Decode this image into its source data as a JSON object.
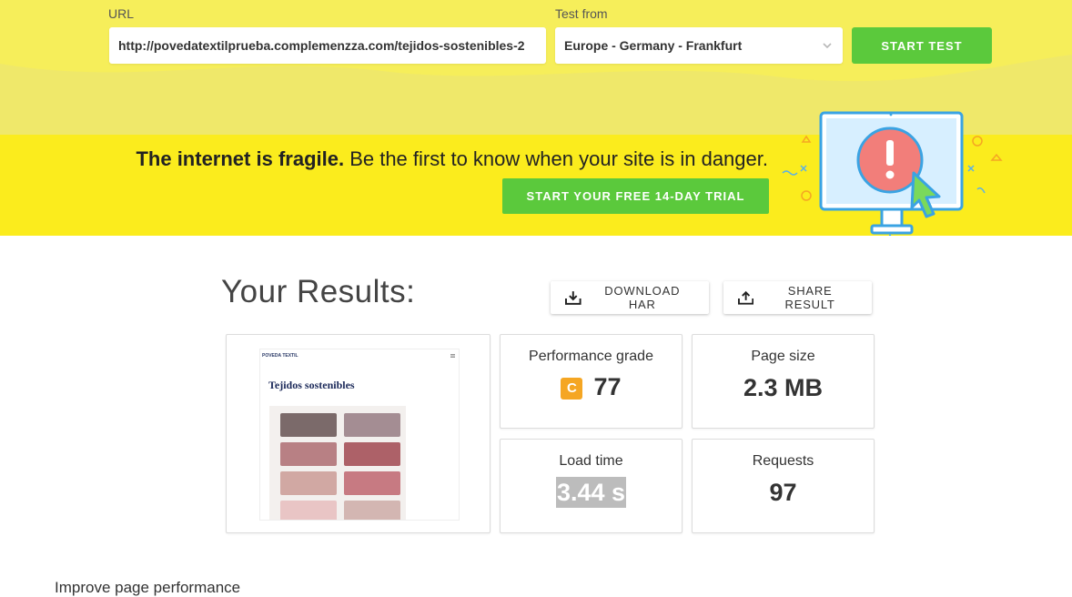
{
  "form": {
    "url_label": "URL",
    "url_value": "http://povedatextilprueba.complemenzza.com/tejidos-sostenibles-2",
    "test_from_label": "Test from",
    "test_from_value": "Europe - Germany - Frankfurt",
    "start_button": "START TEST"
  },
  "promo": {
    "headline_bold": "The internet is fragile.",
    "headline_rest": " Be the first to know when your site is in danger.",
    "trial_button": "START YOUR FREE 14-DAY TRIAL"
  },
  "results": {
    "title": "Your Results:",
    "download_har": "DOWNLOAD HAR",
    "share_result": "SHARE RESULT",
    "screenshot": {
      "logo": "POVEDA TEXTIL",
      "heading": "Tejidos sostenibles"
    },
    "performance_grade": {
      "label": "Performance grade",
      "grade": "C",
      "score": "77"
    },
    "page_size": {
      "label": "Page size",
      "value": "2.3 MB"
    },
    "load_time": {
      "label": "Load time",
      "value": "3.44 s"
    },
    "requests": {
      "label": "Requests",
      "value": "97"
    }
  },
  "footer": {
    "improve_heading": "Improve page performance"
  },
  "colors": {
    "top_band": "#f6ee5a",
    "promo_band": "#fbec1d",
    "green": "#5bc93c",
    "grade_c": "#f5a623"
  }
}
